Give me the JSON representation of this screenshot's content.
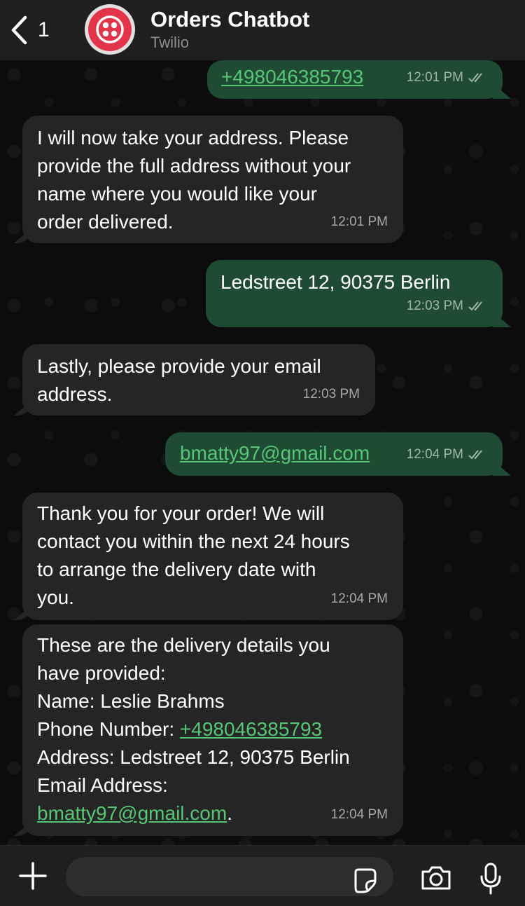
{
  "header": {
    "back_count": "1",
    "title": "Orders Chatbot",
    "subtitle": "Twilio"
  },
  "messages": [
    {
      "dir": "out",
      "parts": [
        {
          "text": "+498046385793",
          "link": true
        }
      ],
      "time": "12:01 PM",
      "ticks": true
    },
    {
      "dir": "in",
      "parts": [
        {
          "text": "I will now take your address. Please\nprovide the full address without your\nname where you would like your\norder delivered."
        }
      ],
      "time": "12:01 PM"
    },
    {
      "dir": "out",
      "parts": [
        {
          "text": "Ledstreet 12, 90375 Berlin"
        }
      ],
      "time": "12:03 PM",
      "ticks": true
    },
    {
      "dir": "in",
      "parts": [
        {
          "text": "Lastly, please provide your email\naddress."
        }
      ],
      "time": "12:03 PM"
    },
    {
      "dir": "out",
      "parts": [
        {
          "text": "bmatty97@gmail.com",
          "link": true
        }
      ],
      "time": "12:04 PM",
      "ticks": true
    },
    {
      "dir": "in",
      "parts": [
        {
          "text": "Thank you for your order! We will\ncontact you within the next 24 hours\nto arrange the delivery date with\nyou."
        }
      ],
      "time": "12:04 PM"
    },
    {
      "dir": "in",
      "parts": [
        {
          "text": "These are the delivery details you\nhave provided:\nName: Leslie Brahms\nPhone Number: "
        },
        {
          "text": "+498046385793",
          "link": true
        },
        {
          "text": "\nAddress: Ledstreet 12, 90375 Berlin\nEmail Address:\n"
        },
        {
          "text": "bmatty97@gmail.com",
          "link": true
        },
        {
          "text": "."
        }
      ],
      "time": "12:04 PM"
    }
  ],
  "composer": {
    "placeholder": ""
  },
  "icons": {
    "back": "chevron-left-icon",
    "plus": "plus-icon",
    "sticker": "sticker-icon",
    "camera": "camera-icon",
    "mic": "microphone-icon"
  },
  "colors": {
    "incoming_bubble": "#252525",
    "outgoing_bubble": "#1f4a33",
    "link": "#56c775",
    "avatar": "#e3354a"
  }
}
